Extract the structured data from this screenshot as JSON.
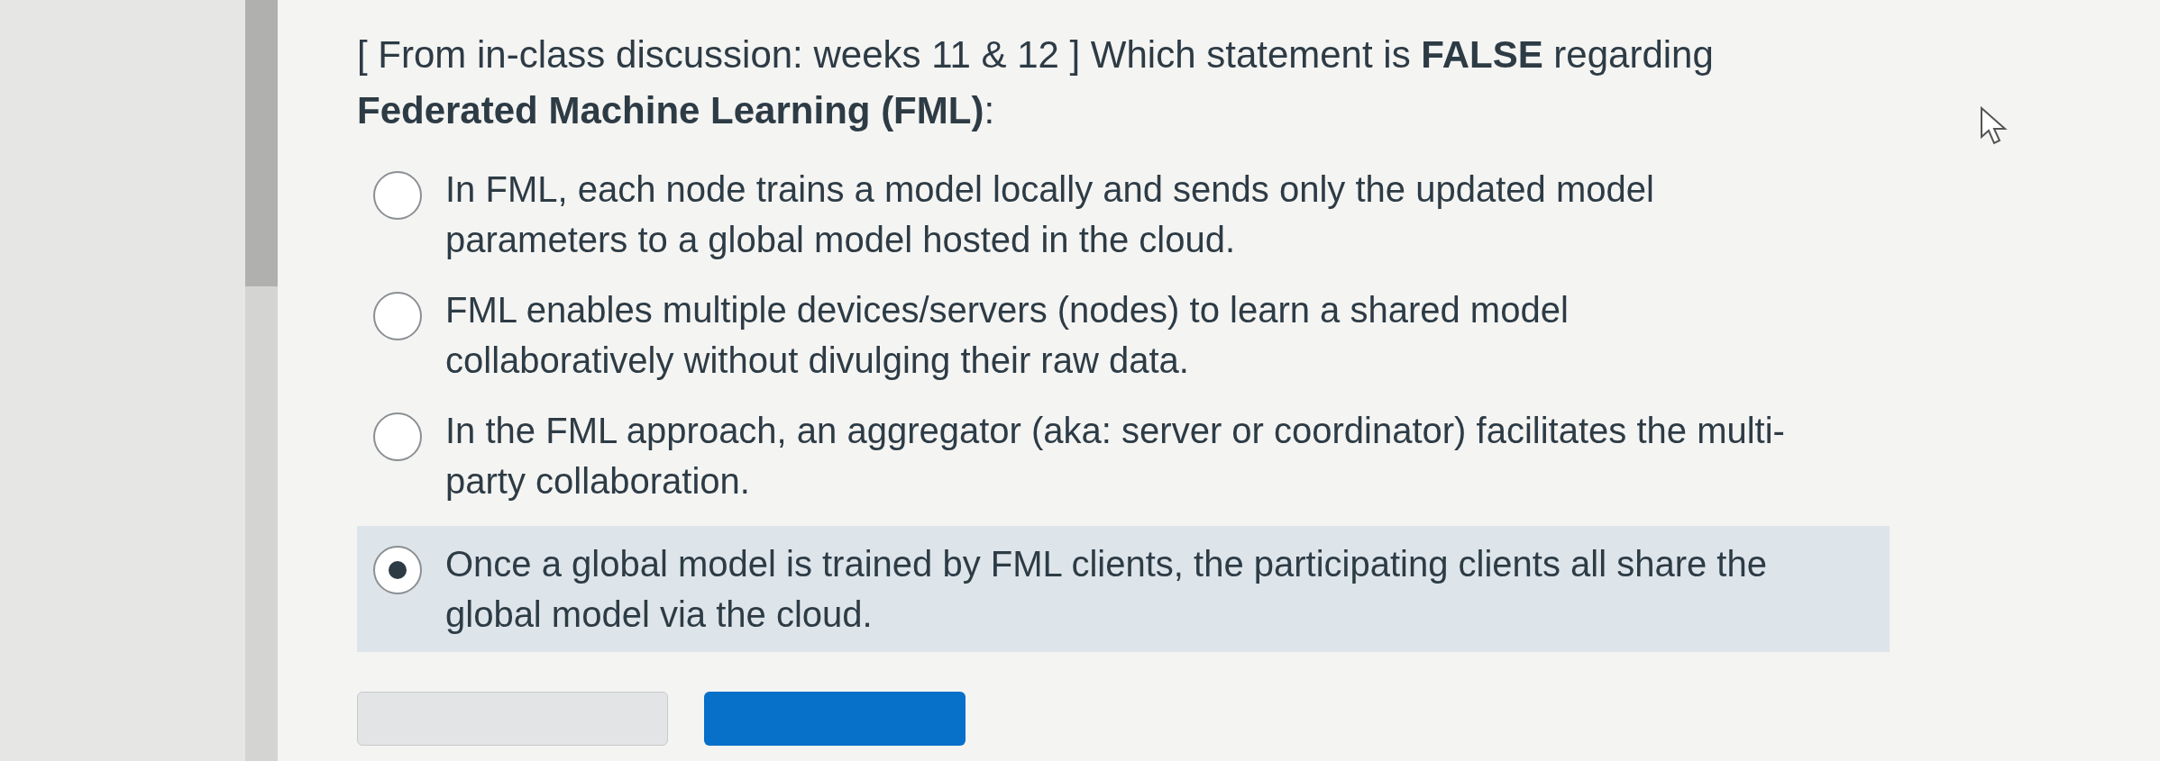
{
  "question": "[ From in-class discussion: weeks 11 & 12 ]  Which statement is **FALSE** regarding **Federated Machine Learning (FML)**:",
  "options": [
    {
      "text": "In FML, each node trains a model locally and sends only the updated model parameters to a global model hosted in the cloud.",
      "selected": false
    },
    {
      "text": "FML enables multiple devices/servers (nodes) to learn a shared model collaboratively without divulging their raw data.",
      "selected": false
    },
    {
      "text": "In the FML approach, an aggregator (aka: server or coordinator) facilitates the multi-party collaboration.",
      "selected": false
    },
    {
      "text": "Once a global model is trained by FML clients, the participating clients all share the global model via the cloud.",
      "selected": true
    }
  ],
  "buttons": [
    {
      "kind": "secondary"
    },
    {
      "kind": "primary"
    }
  ]
}
